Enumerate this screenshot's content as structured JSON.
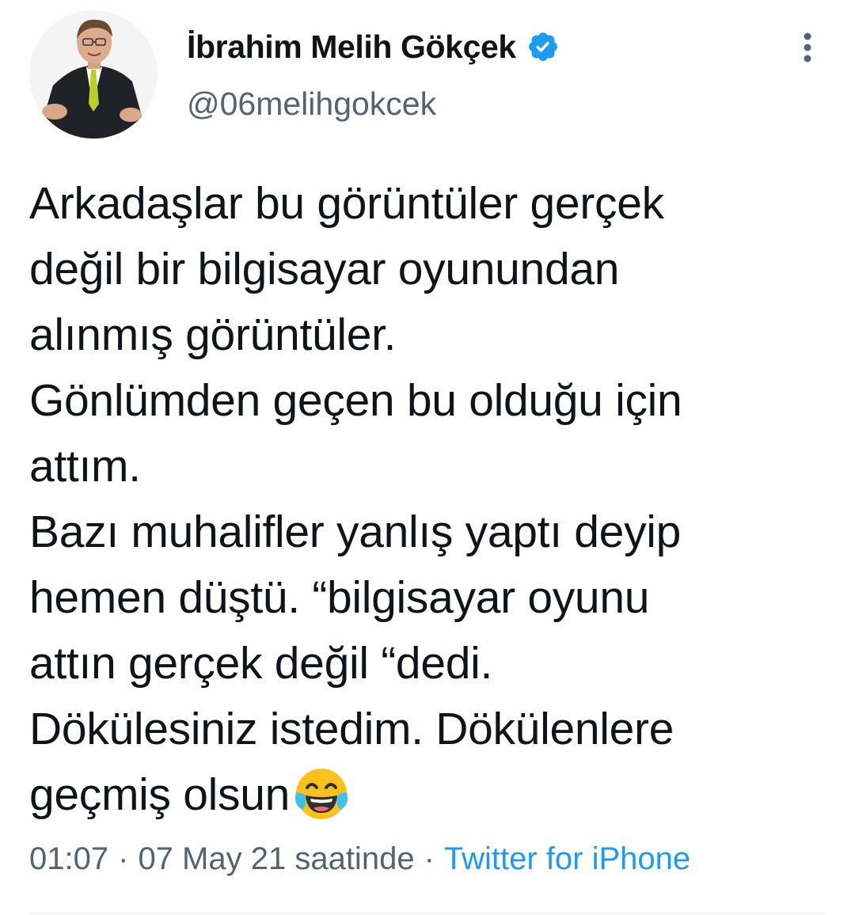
{
  "author": {
    "display_name": "İbrahim Melih Gökçek",
    "handle": "@06melihgokcek",
    "verified": true,
    "avatar_icon": "profile-photo"
  },
  "menu": {
    "icon": "more-vertical-icon"
  },
  "tweet": {
    "lines": [
      "Arkadaşlar bu görüntüler gerçek",
      "değil bir bilgisayar oyunundan",
      "alınmış görüntüler.",
      "Gönlümden geçen bu olduğu için",
      "attım.",
      "Bazı muhalifler yanlış yaptı deyip",
      "hemen düştü. “bilgisayar oyunu",
      "attın gerçek değil “dedi.",
      "Dökülesiniz istedim. Dökülenlere",
      "geçmiş olsun"
    ],
    "trailing_emoji": "face-with-tears-of-joy-icon"
  },
  "meta": {
    "time": "01:07",
    "separator": "·",
    "date": "07 May 21 saatinde",
    "separator2": "·",
    "source": "Twitter for iPhone"
  },
  "colors": {
    "text": "#0f1419",
    "secondary": "#536471",
    "accent": "#1d9bf0",
    "divider": "#eff3f4"
  }
}
